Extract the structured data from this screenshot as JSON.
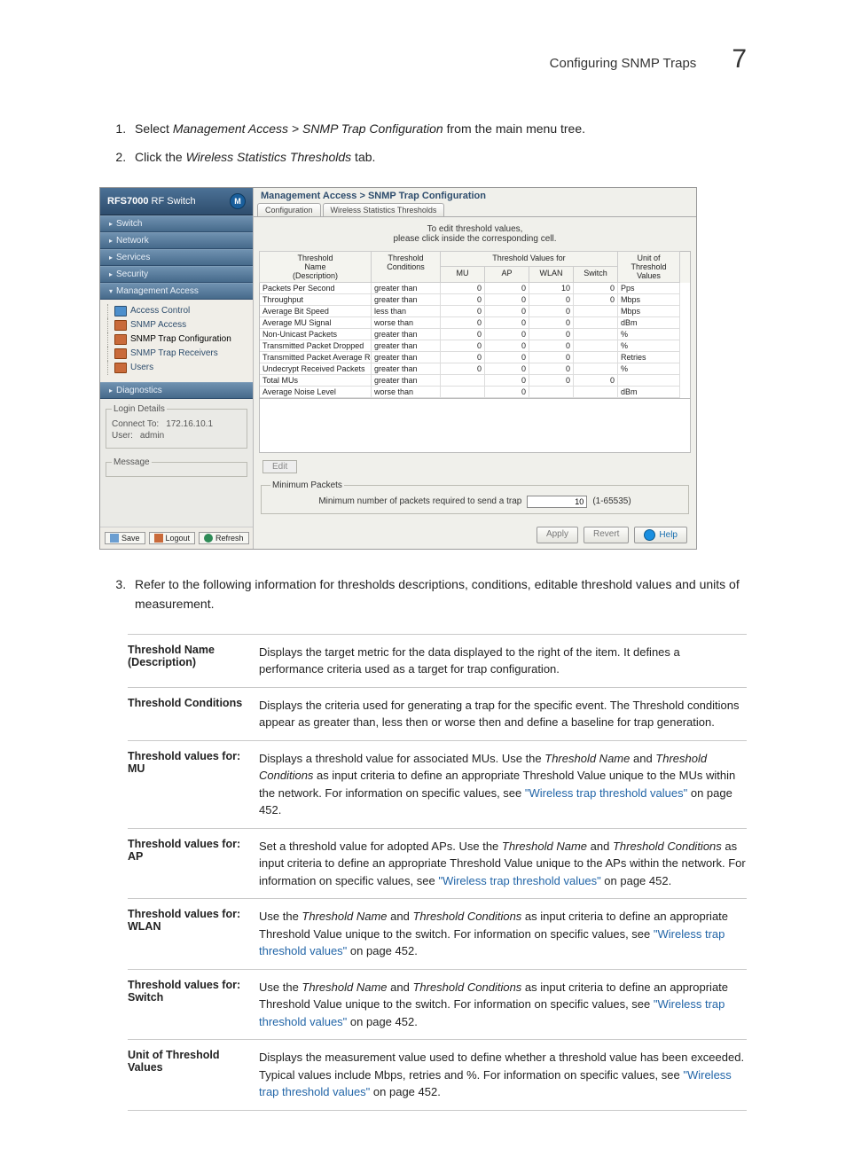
{
  "header": {
    "title": "Configuring SNMP Traps",
    "chapter": "7"
  },
  "steps": {
    "s1_a": "Select ",
    "s1_b": "Management Access > SNMP Trap Configuration",
    "s1_c": " from the main menu tree.",
    "s2_a": "Click the ",
    "s2_b": "Wireless Statistics Thresholds",
    "s2_c": " tab.",
    "s3": "Refer to the following information for thresholds descriptions, conditions, editable threshold values and units of measurement."
  },
  "app": {
    "brand_a": "RFS7000",
    "brand_b": " RF Switch",
    "nav": [
      "Switch",
      "Network",
      "Services",
      "Security",
      "Management Access",
      "Diagnostics"
    ],
    "tree": {
      "items": [
        {
          "label": "Access Control"
        },
        {
          "label": "SNMP Access"
        },
        {
          "label": "SNMP Trap Configuration"
        },
        {
          "label": "SNMP Trap Receivers"
        },
        {
          "label": "Users"
        }
      ]
    },
    "login": {
      "legend": "Login Details",
      "connect_lbl": "Connect To:",
      "connect_val": "172.16.10.1",
      "user_lbl": "User:",
      "user_val": "admin",
      "msg_legend": "Message"
    },
    "sb_buttons": {
      "save": "Save",
      "logout": "Logout",
      "refresh": "Refresh"
    },
    "crumb": "Management Access > SNMP Trap Configuration",
    "tabs": [
      "Configuration",
      "Wireless Statistics Thresholds"
    ],
    "hint_a": "To edit threshold values,",
    "hint_b": "please click inside the corresponding cell.",
    "grid": {
      "h_name": "Threshold\nName\n(Description)",
      "h_cond": "Threshold\nConditions",
      "h_vals": "Threshold Values for",
      "h_mu": "MU",
      "h_ap": "AP",
      "h_wlan": "WLAN",
      "h_switch": "Switch",
      "h_unit": "Unit of\nThreshold\nValues",
      "rows": [
        {
          "name": "Packets Per Second",
          "cond": "greater than",
          "mu": "0",
          "ap": "0",
          "wlan": "10",
          "sw": "0",
          "u": "Pps"
        },
        {
          "name": "Throughput",
          "cond": "greater than",
          "mu": "0",
          "ap": "0",
          "wlan": "0",
          "sw": "0",
          "u": "Mbps"
        },
        {
          "name": "Average Bit Speed",
          "cond": "less than",
          "mu": "0",
          "ap": "0",
          "wlan": "0",
          "sw": "",
          "u": "Mbps"
        },
        {
          "name": "Average MU Signal",
          "cond": "worse than",
          "mu": "0",
          "ap": "0",
          "wlan": "0",
          "sw": "",
          "u": "dBm"
        },
        {
          "name": "Non-Unicast Packets",
          "cond": "greater than",
          "mu": "0",
          "ap": "0",
          "wlan": "0",
          "sw": "",
          "u": "%"
        },
        {
          "name": "Transmitted Packet Dropped",
          "cond": "greater than",
          "mu": "0",
          "ap": "0",
          "wlan": "0",
          "sw": "",
          "u": "%"
        },
        {
          "name": "Transmitted Packet Average Retries",
          "cond": "greater than",
          "mu": "0",
          "ap": "0",
          "wlan": "0",
          "sw": "",
          "u": "Retries"
        },
        {
          "name": "Undecrypt Received Packets",
          "cond": "greater than",
          "mu": "0",
          "ap": "0",
          "wlan": "0",
          "sw": "",
          "u": "%"
        },
        {
          "name": "Total MUs",
          "cond": "greater than",
          "mu": "",
          "ap": "0",
          "wlan": "0",
          "sw": "0",
          "u": ""
        },
        {
          "name": "Average Noise Level",
          "cond": "worse than",
          "mu": "",
          "ap": "0",
          "wlan": "",
          "sw": "",
          "u": "dBm"
        }
      ]
    },
    "edit": "Edit",
    "minp": {
      "legend": "Minimum Packets",
      "label": "Minimum number of packets required to send a trap",
      "value": "10",
      "range": "(1-65535)"
    },
    "buttons": {
      "apply": "Apply",
      "revert": "Revert",
      "help": "Help"
    }
  },
  "desc": [
    {
      "label": "Threshold Name (Description)",
      "html": "Displays the target metric for the data displayed to the right of the item. It defines a performance criteria used as a target for trap configuration."
    },
    {
      "label": "Threshold Conditions",
      "html": "Displays the criteria used for generating a trap for the specific event. The Threshold conditions appear as greater than, less then or worse then and define a baseline for trap generation."
    },
    {
      "label": "Threshold values for: MU",
      "html": "Displays a threshold value for associated MUs. Use the <em>Threshold Name</em> and <em>Threshold Conditions</em> as input criteria to define an appropriate Threshold Value unique to the MUs within the network. For information on specific values, see <a class='link' href='#'>\"Wireless trap threshold values\"</a> on page 452."
    },
    {
      "label": "Threshold values for: AP",
      "html": "Set a threshold value for adopted APs. Use the <em>Threshold Name</em> and <em>Threshold Conditions</em> as input criteria to define an appropriate Threshold Value unique to the APs within the network. For information on specific values, see <a class='link' href='#'>\"Wireless trap threshold values\"</a> on page 452."
    },
    {
      "label": "Threshold values for: WLAN",
      "html": "Use the <em>Threshold Name</em> and <em>Threshold Conditions</em> as input criteria to define an appropriate Threshold Value unique to the switch. For information on specific values, see <a class='link' href='#'>\"Wireless trap threshold values\"</a> on page 452."
    },
    {
      "label": "Threshold values for: Switch",
      "html": "Use the <em>Threshold Name</em> and <em>Threshold Conditions</em> as input criteria to define an appropriate Threshold Value unique to the switch. For information on specific values, see <a class='link' href='#'>\"Wireless trap threshold values\"</a> on page 452."
    },
    {
      "label": "Unit of Threshold Values",
      "html": "Displays the measurement value used to define whether a threshold value has been exceeded. Typical values include Mbps, retries and %. For information on specific values, see <a class='link' href='#'>\"Wireless trap threshold values\"</a> on page 452."
    }
  ]
}
